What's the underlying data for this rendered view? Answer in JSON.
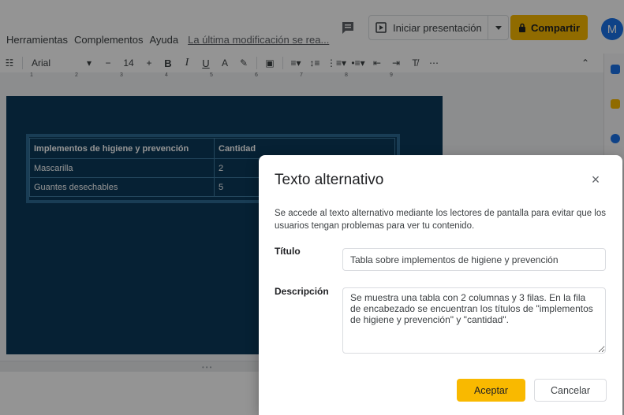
{
  "menu": {
    "items": [
      "Herramientas",
      "Complementos",
      "Ayuda"
    ],
    "last_modified": "La última modificación se rea..."
  },
  "header": {
    "present_label": "Iniciar presentación",
    "share_label": "Compartir",
    "avatar_initial": "M"
  },
  "toolbar": {
    "font": "Arial",
    "font_size": "14",
    "bold": "B",
    "italic": "I",
    "underline": "U",
    "text_color": "A"
  },
  "ruler": {
    "ticks": [
      "1",
      "2",
      "3",
      "4",
      "5",
      "6",
      "7",
      "8",
      "9"
    ]
  },
  "slide_table": {
    "headers": [
      "Implementos de higiene y prevención",
      "Cantidad"
    ],
    "rows": [
      [
        "Mascarilla",
        "2"
      ],
      [
        "Guantes desechables",
        "5"
      ]
    ]
  },
  "dialog": {
    "title": "Texto alternativo",
    "description": "Se accede al texto alternativo mediante los lectores de pantalla para evitar que los usuarios tengan problemas para ver tu contenido.",
    "title_label": "Título",
    "title_value": "Tabla sobre implementos de higiene y prevención",
    "description_label": "Descripción",
    "description_value": "Se muestra una tabla con 2 columnas y 3 filas. En la fila de encabezado se encuentran los títulos de \"implementos de higiene y prevención\" y \"cantidad\".",
    "ok_label": "Aceptar",
    "cancel_label": "Cancelar"
  },
  "colors": {
    "accent": "#f9b900",
    "slide_bg": "#0b3a5a",
    "avatar": "#1a73e8"
  }
}
